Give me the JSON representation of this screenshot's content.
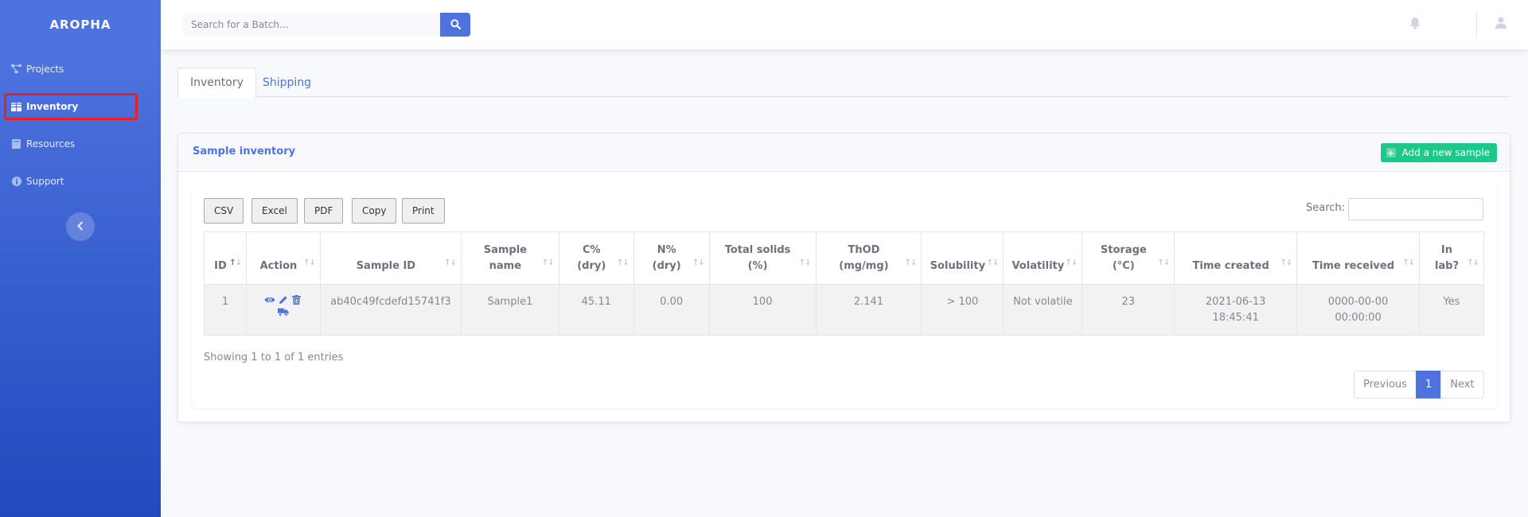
{
  "app": {
    "brand": "AROPHA"
  },
  "sidebar": {
    "items": [
      {
        "label": "Projects",
        "icon": "project-diagram-icon"
      },
      {
        "label": "Inventory",
        "icon": "table-icon",
        "active": true
      },
      {
        "label": "Resources",
        "icon": "book-icon"
      },
      {
        "label": "Support",
        "icon": "info-circle-icon"
      }
    ],
    "toggle_icon": "chevron-left-icon"
  },
  "topbar": {
    "search_placeholder": "Search for a Batch...",
    "icons": [
      "search-icon",
      "bell-icon",
      "user-icon"
    ]
  },
  "tabs": [
    {
      "label": "Inventory",
      "active": true
    },
    {
      "label": "Shipping",
      "active": false
    }
  ],
  "card": {
    "title": "Sample inventory",
    "add_button": "Add a new sample",
    "export_buttons": [
      "CSV",
      "Excel",
      "PDF",
      "Copy",
      "Print"
    ],
    "search_label": "Search:",
    "columns": [
      [
        "ID"
      ],
      [
        "Action"
      ],
      [
        "Sample ID"
      ],
      [
        "Sample",
        "name"
      ],
      [
        "C%",
        "(dry)"
      ],
      [
        "N%",
        "(dry)"
      ],
      [
        "Total solids",
        "(%)"
      ],
      [
        "ThOD",
        "(mg/mg)"
      ],
      [
        "Solubility"
      ],
      [
        "Volatility"
      ],
      [
        "Storage",
        "(°C)"
      ],
      [
        "Time created"
      ],
      [
        "Time received"
      ],
      [
        "In",
        "lab?"
      ]
    ],
    "rows": [
      {
        "id": "1",
        "sample_id": "ab40c49fcdefd15741f3",
        "sample_name": "Sample1",
        "c_dry": "45.11",
        "n_dry": "0.00",
        "total_solids": "100",
        "thod": "2.141",
        "solubility": "> 100",
        "volatility": "Not volatile",
        "storage": "23",
        "time_created": [
          "2021-06-13",
          "18:45:41"
        ],
        "time_received": [
          "0000-00-00",
          "00:00:00"
        ],
        "in_lab": "Yes",
        "actions": [
          "eye-icon",
          "pencil-icon",
          "trash-icon",
          "truck-icon"
        ]
      }
    ],
    "info": "Showing 1 to 1 of 1 entries",
    "pagination": {
      "previous": "Previous",
      "current": "1",
      "next": "Next"
    }
  },
  "colors": {
    "primary": "#4e73df",
    "success": "#1cc88a",
    "highlight": "#e02424"
  }
}
